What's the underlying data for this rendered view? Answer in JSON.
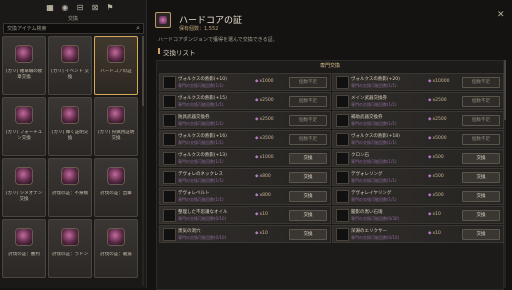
{
  "left_panel": {
    "icon_tabs": [
      {
        "name": "grid-icon",
        "glyph": "▦"
      },
      {
        "name": "location-icon",
        "glyph": "◉"
      },
      {
        "name": "chest-icon",
        "glyph": "⊟"
      },
      {
        "name": "scroll-icon",
        "glyph": "⊠"
      },
      {
        "name": "bookmark-icon",
        "glyph": "⚑"
      }
    ],
    "tab_caption": "交換",
    "search_placeholder": "交換アイテム検索",
    "cards": [
      {
        "label": "[カリ] 羅卓職の紋章交換"
      },
      {
        "label": "[カリ] イベント 交換"
      },
      {
        "label": "ハードコアの証",
        "selected": true
      },
      {
        "label": "[カリ] フォーチュン交換"
      },
      {
        "label": "[カリ] 輝く証明交換"
      },
      {
        "label": "[カリ] 狩猟用証明交換"
      },
      {
        "label": "[カリ] シメオナン 交換"
      },
      {
        "label": "討伐の証：不帰橋"
      },
      {
        "label": "討伐の証：出撃"
      },
      {
        "label": "討伐の証：審判"
      },
      {
        "label": "討伐の証：ラドン"
      },
      {
        "label": "討伐の証：破滅"
      }
    ]
  },
  "header": {
    "title": "ハードコアの証",
    "holding": "保有個数：1,552",
    "description": "ハードコアダンジョンで獲得を選んで交換できる証。",
    "section_title": "交換リスト",
    "list_header": "専門交換"
  },
  "exchange_items": [
    {
      "name": "ヴォルクスの熱影(+10)",
      "sub": "専門の交換可能回数(1/1)",
      "cost": "x1000",
      "button": "個数不足",
      "disabled": true
    },
    {
      "name": "ヴォルクスの熱影(+20)",
      "sub": "専門の交換可能回数(1/1)",
      "cost": "x10000",
      "button": "個数不足",
      "disabled": true
    },
    {
      "name": "ヴォルクスの熱影(+15)",
      "sub": "専門の交換可能回数(1/1)",
      "cost": "x2500",
      "button": "個数不足",
      "disabled": true
    },
    {
      "name": "メイン武器交換券",
      "sub": "専門の交換可能回数(1/1)",
      "cost": "x2500",
      "button": "個数不足",
      "disabled": true
    },
    {
      "name": "防具武器交換券",
      "sub": "専門の交換可能回数(1/1)",
      "cost": "x2500",
      "button": "個数不足",
      "disabled": true
    },
    {
      "name": "補助武器交換券",
      "sub": "専門の交換可能回数(1/1)",
      "cost": "x2500",
      "button": "個数不足",
      "disabled": true
    },
    {
      "name": "ヴォルクスの熱影(+16)",
      "sub": "専門の交換可能回数(1/1)",
      "cost": "x3500",
      "button": "個数不足",
      "disabled": true
    },
    {
      "name": "ヴォルクスの熱影(+18)",
      "sub": "専門の交換可能回数(1/1)",
      "cost": "x5000",
      "button": "個数不足",
      "disabled": true
    },
    {
      "name": "ヴォルクスの熱影(+13)",
      "sub": "専門の交換可能回数(1/1)",
      "cost": "x1000",
      "button": "交換",
      "disabled": false
    },
    {
      "name": "クロン石",
      "sub": "専門の交換可能回数(1/1)",
      "cost": "x500",
      "button": "交換",
      "disabled": false
    },
    {
      "name": "デヴォレのネックレス",
      "sub": "専門の交換可能回数(1/1)",
      "cost": "x800",
      "button": "交換",
      "disabled": false
    },
    {
      "name": "デヴォレリング",
      "sub": "専門の交換可能回数(1/1)",
      "cost": "x500",
      "button": "交換",
      "disabled": false
    },
    {
      "name": "デヴォレベルト",
      "sub": "専門の交換可能回数(1/1)",
      "cost": "x800",
      "button": "交換",
      "disabled": false
    },
    {
      "name": "デヴォレイヤリング",
      "sub": "専門の交換可能回数(1/1)",
      "cost": "x500",
      "button": "交換",
      "disabled": false
    },
    {
      "name": "整理した不思議なオイル",
      "sub": "専門の交換可能回数(0/10)",
      "cost": "x10",
      "button": "交換",
      "disabled": false
    },
    {
      "name": "闇影の黒い石塊",
      "sub": "専門の交換可能回数(0/30)",
      "cost": "x10",
      "button": "交換",
      "disabled": false
    },
    {
      "name": "黒気の洞穴",
      "sub": "専門の交換可能回数(0/10)",
      "cost": "x10",
      "button": "交換",
      "disabled": false
    },
    {
      "name": "深淵のエリクサー",
      "sub": "専門の交換可能回数(0/10)",
      "cost": "x10",
      "button": "交換",
      "disabled": false
    }
  ],
  "colors": {
    "accent_gold": "#d7a95a",
    "currency_purple": "#b57ac8"
  }
}
